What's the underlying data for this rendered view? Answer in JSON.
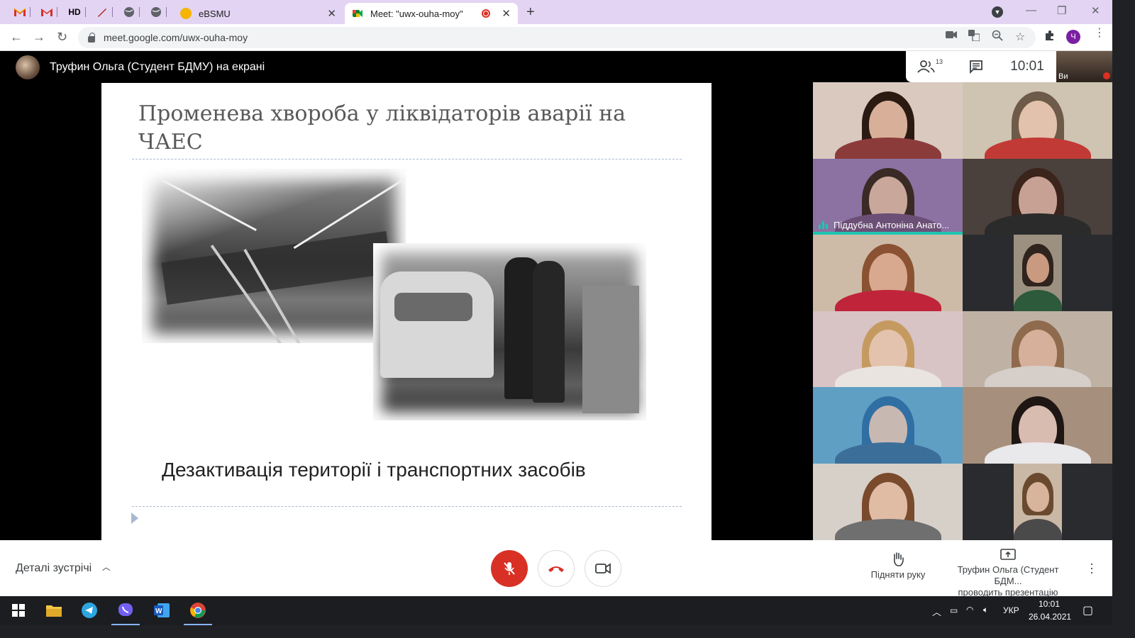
{
  "browser": {
    "mini_tabs": [
      "M",
      "M",
      "HD",
      "",
      "",
      ""
    ],
    "tabs": [
      {
        "title": "eBSMU",
        "active": false
      },
      {
        "title": "Meet: \"uwx-ouha-moy\"",
        "active": true
      }
    ],
    "url": "meet.google.com/uwx-ouha-moy",
    "profile_initial": "Ч"
  },
  "meet": {
    "presenter_banner": "Труфин Ольга (Студент БДМУ) на екрані",
    "participants_count": "13",
    "clock": "10:01",
    "self_label": "Ви",
    "slide": {
      "title": "Променева хвороба у ліквідаторів аварії на ЧАЕС",
      "caption": "Дезактивація території і транспортних засобів"
    },
    "tiles": [
      {
        "skin": "#d8b09a",
        "hair": "#2b1a12",
        "body": "#8c3b3b",
        "bg": "#d9c9bf",
        "name": ""
      },
      {
        "skin": "#e2c2ac",
        "hair": "#6e5a48",
        "body": "#c23a35",
        "bg": "#cfc3b2",
        "name": ""
      },
      {
        "skin": "#c9a79b",
        "hair": "#3a2a25",
        "body": "#6c4f77",
        "bg": "#8b72a3",
        "name": "Піддубна Антоніна Анато...",
        "speaking": true
      },
      {
        "skin": "#c7a294",
        "hair": "#3b241b",
        "body": "#2b2b2b",
        "bg": "#4a403c",
        "name": ""
      },
      {
        "skin": "#d8a88f",
        "hair": "#8a5232",
        "body": "#c0243a",
        "bg": "#cdbba7",
        "name": ""
      },
      {
        "skin": "#c99a80",
        "hair": "#2f241d",
        "body": "#2c5a3b",
        "bg": "#9c9080",
        "name": "",
        "narrow": true
      },
      {
        "skin": "#e3c3ad",
        "hair": "#c59a60",
        "body": "#e9e4df",
        "bg": "#d8c3c5",
        "name": ""
      },
      {
        "skin": "#d6b09b",
        "hair": "#8f6a4c",
        "body": "#d6cfc9",
        "bg": "#bfb2a5",
        "name": ""
      },
      {
        "skin": "#c8b8b2",
        "hair": "#2f6fa3",
        "body": "#3b6f9a",
        "bg": "#5f9fc4",
        "name": ""
      },
      {
        "skin": "#d8bcb0",
        "hair": "#1e1613",
        "body": "#e9e8ea",
        "bg": "#a68f7c",
        "name": ""
      },
      {
        "skin": "#e0bca5",
        "hair": "#7a4a2c",
        "body": "#6f6f6f",
        "bg": "#d7d0c9",
        "name": ""
      },
      {
        "skin": "#d9b49c",
        "hair": "#6a4a2e",
        "body": "#4a4a4a",
        "bg": "#c9b8a5",
        "name": "",
        "narrow": true
      }
    ],
    "bottom": {
      "details_label": "Деталі зустрічі",
      "raise_hand": "Підняти руку",
      "presenting_name": "Труфин Ольга (Студент БДМ...",
      "presenting_status": "проводить презентацію"
    }
  },
  "taskbar": {
    "language": "УКР",
    "time": "10:01",
    "date": "26.04.2021"
  },
  "colors": {
    "tabstrip": "#e3d4f3",
    "mic_off_red": "#d93025",
    "speaking_teal": "#1ec6b1"
  },
  "icons": [
    "gmail-icon",
    "hd-icon",
    "pen-icon",
    "globe-icon",
    "chrome-icon",
    "meet-icon",
    "record-icon",
    "lock-icon",
    "camera-icon",
    "translate-icon",
    "zoom-icon",
    "star-icon",
    "extensions-icon",
    "people-icon",
    "chat-icon",
    "mic-off-icon",
    "hang-up-icon",
    "camera-toggle-icon",
    "hand-icon",
    "present-icon",
    "windows-icon",
    "folder-icon",
    "telegram-icon",
    "viber-icon",
    "word-icon"
  ]
}
